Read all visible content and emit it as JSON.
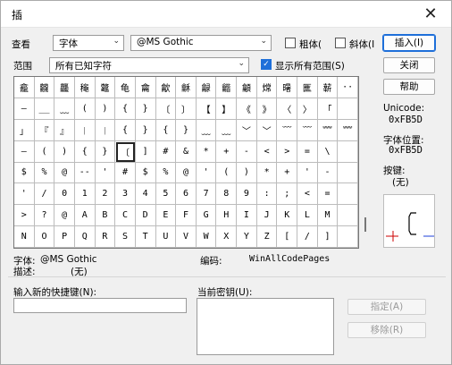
{
  "window": {
    "title": "插",
    "close_glyph": "✕"
  },
  "lookup": {
    "label": "查看",
    "view_value": "字体",
    "font_value": "@MS Gothic",
    "bold_label": "粗体(",
    "italic_label": "斜体(I",
    "insert_button": "插入(I)"
  },
  "range": {
    "label": "范围",
    "value": "所有已知字符",
    "show_all_label": "显示所有范围(S)",
    "show_all_checked": true,
    "close_button": "关闭",
    "help_button": "帮助"
  },
  "grid": {
    "rows": [
      [
        "龕",
        "龖",
        "龘",
        "龝",
        "龞",
        "龟",
        "龠",
        "龡",
        "龢",
        "龣",
        "龤",
        "龥",
        "龦",
        "龧",
        "龨",
        "龩",
        "··"
      ],
      [
        "—",
        "__",
        "﹏",
        "(",
        ")",
        "{",
        "}",
        "〔",
        "〕",
        "【",
        "】",
        "《",
        "》",
        "〈",
        "〉",
        "「"
      ],
      [
        "」",
        "『",
        "』",
        "︱",
        "︱",
        "{",
        "}",
        "{",
        "}",
        "﹏",
        "﹏",
        "﹀",
        "﹀",
        "﹋",
        "﹋",
        "﹌",
        "﹌"
      ],
      [
        "—",
        "(",
        ")",
        "{",
        "}",
        "〔",
        "]",
        "#",
        "&",
        "*",
        "+",
        "-",
        "<",
        ">",
        "=",
        "\\"
      ],
      [
        "$",
        "%",
        "@",
        "--",
        "'",
        "#",
        "$",
        "%",
        "@",
        "'",
        "(",
        ")",
        "*",
        "+",
        "'",
        "-"
      ],
      [
        "'",
        "/",
        "0",
        "1",
        "2",
        "3",
        "4",
        "5",
        "6",
        "7",
        "8",
        "9",
        ":",
        ";",
        "<",
        "=",
        ""
      ],
      [
        ">",
        "?",
        "@",
        "A",
        "B",
        "C",
        "D",
        "E",
        "F",
        "G",
        "H",
        "I",
        "J",
        "K",
        "L",
        "M",
        ""
      ],
      [
        "N",
        "O",
        "P",
        "Q",
        "R",
        "S",
        "T",
        "U",
        "V",
        "W",
        "X",
        "Y",
        "Z",
        "[",
        "/",
        "]",
        ""
      ]
    ],
    "selected_row": 3,
    "selected_col": 5
  },
  "info": {
    "unicode_label": "Unicode:",
    "unicode_value": "0xFB5D",
    "pos_label": "字体位置:",
    "pos_value": "0xFB5D",
    "key_label": "按键:",
    "key_value": "(无)"
  },
  "status": {
    "font_label": "字体:",
    "font_value": "@MS Gothic",
    "encoding_label": "编码:",
    "encoding_value": "WinAllCodePages",
    "desc_label": "描述:",
    "desc_value": "(无)"
  },
  "shortcut": {
    "new_label": "输入新的快捷键(N):",
    "current_label": "当前密钥(U):",
    "assign_button": "指定(A)",
    "remove_button": "移除(R)"
  },
  "colors": {
    "accent": "#1e6fd9",
    "preview_red": "#cc0000",
    "preview_blue": "#1e3fd9"
  }
}
